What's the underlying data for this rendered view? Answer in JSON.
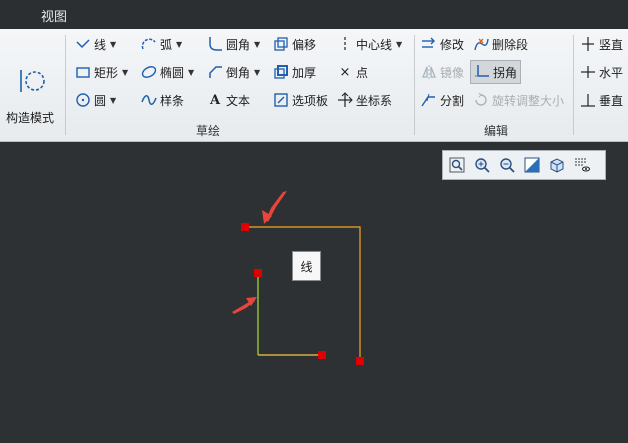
{
  "menubar": {
    "view_label": "视图"
  },
  "ribbon": {
    "construction_mode": {
      "label": "构造模式",
      "icon": "construction-mode-icon"
    },
    "sketch_group": {
      "label": "草绘",
      "tools": [
        {
          "label": "线",
          "icon": "line-icon",
          "dropdown": true
        },
        {
          "label": "矩形",
          "icon": "rectangle-icon",
          "dropdown": true
        },
        {
          "label": "圆",
          "icon": "circle-icon",
          "dropdown": true
        },
        {
          "label": "弧",
          "icon": "arc-icon",
          "dropdown": true
        },
        {
          "label": "椭圆",
          "icon": "ellipse-icon",
          "dropdown": true
        },
        {
          "label": "样条",
          "icon": "spline-icon",
          "dropdown": false
        },
        {
          "label": "圆角",
          "icon": "fillet-icon",
          "dropdown": true
        },
        {
          "label": "倒角",
          "icon": "chamfer-icon",
          "dropdown": true
        },
        {
          "label": "文本",
          "icon": "text-icon",
          "dropdown": false
        },
        {
          "label": "偏移",
          "icon": "offset-icon",
          "dropdown": false
        },
        {
          "label": "加厚",
          "icon": "thicken-icon",
          "dropdown": false
        },
        {
          "label": "选项板",
          "icon": "palette-icon",
          "dropdown": false
        },
        {
          "label": "中心线",
          "icon": "centerline-icon",
          "dropdown": true
        },
        {
          "label": "点",
          "icon": "point-icon",
          "dropdown": false
        },
        {
          "label": "坐标系",
          "icon": "coordinate-system-icon",
          "dropdown": false
        }
      ]
    },
    "edit_group": {
      "label": "编辑",
      "tools": [
        {
          "label": "修改",
          "icon": "modify-icon",
          "disabled": false
        },
        {
          "label": "镜像",
          "icon": "mirror-icon",
          "disabled": true
        },
        {
          "label": "分割",
          "icon": "divide-icon",
          "disabled": false
        },
        {
          "label": "删除段",
          "icon": "delete-segment-icon",
          "disabled": false
        },
        {
          "label": "拐角",
          "icon": "corner-icon",
          "disabled": false,
          "pressed": true
        },
        {
          "label": "旋转调整大小",
          "icon": "rotate-resize-icon",
          "disabled": true
        }
      ]
    },
    "constrain_group": {
      "tools": [
        {
          "label": "竖直",
          "icon": "vertical-constraint-icon"
        },
        {
          "label": "水平",
          "icon": "horizontal-constraint-icon"
        },
        {
          "label": "垂直",
          "icon": "perpendicular-constraint-icon"
        }
      ]
    }
  },
  "view_toolbar": {
    "buttons": [
      "refit-icon",
      "zoom-in-icon",
      "zoom-out-icon",
      "repaint-icon",
      "display-style-icon",
      "sketcher-display-filter-icon"
    ]
  },
  "canvas": {
    "tooltip": "线",
    "colors": {
      "background": "#2d3133",
      "line_orange": "#f5a623",
      "line_green": "#a6e22e",
      "vertex": "#e00000",
      "arrow": "#e8453c"
    }
  }
}
